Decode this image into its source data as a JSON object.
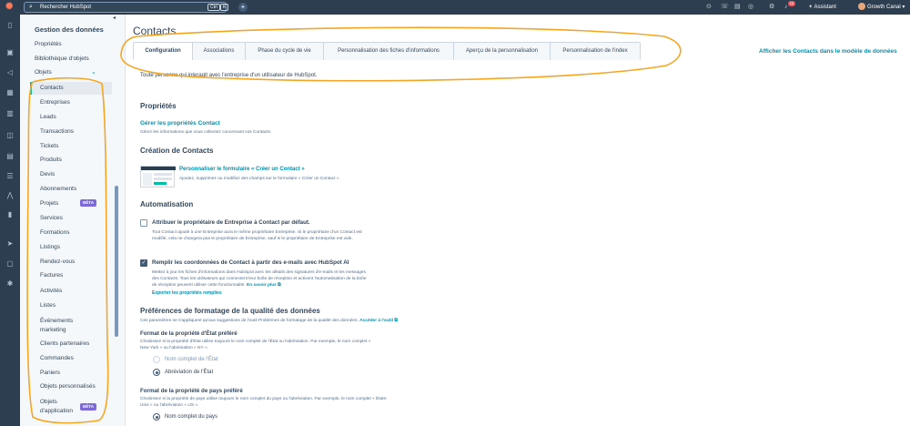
{
  "topbar": {
    "search_placeholder": "Rechercher HubSpot",
    "kbd_ctrl": "Ctrl",
    "kbd_k": "K",
    "notif_count": "18",
    "assistant": "Assistant",
    "account": "Growth Canal"
  },
  "sidebar": {
    "title": "Gestion des données",
    "links": [
      "Propriétés",
      "Bibliothèque d'objets"
    ],
    "objects_label": "Objets",
    "items": [
      "Contacts",
      "Entreprises",
      "Leads",
      "Transactions",
      "Tickets",
      "Produits",
      "Devis",
      "Abonnements",
      "Projets",
      "Services",
      "Formations",
      "Listings",
      "Rendez-vous",
      "Factures",
      "Activités",
      "Listes",
      "Événements marketing",
      "Clients partenaires",
      "Commandes",
      "Paniers",
      "Objets personnalisés",
      "Objets d'application"
    ],
    "beta": "BÊTA"
  },
  "main": {
    "title": "Contacts",
    "tabs": [
      "Configuration",
      "Associations",
      "Phase du cycle de vie",
      "Personnalisation des fiches d'informations",
      "Aperçu de la personnalisation",
      "Personnalisation de l'index"
    ],
    "model_link": "Afficher les Contacts dans le modèle de données",
    "description": "Toute personne qui interagit avec l'entreprise d'un utilisateur de HubSpot.",
    "props_heading": "Propriétés",
    "props_link": "Gérer les propriétés Contact",
    "props_desc": "Gérez les informations que vous collectez concernant vos Contacts.",
    "creation_heading": "Création de Contacts",
    "creation_link": "Personnaliser le formulaire « Créer un Contact »",
    "creation_desc": "Ajoutez, supprimez ou modifiez des champs sur le formulaire « Créer un Contact ».",
    "auto_heading": "Automatisation",
    "cb1_label": "Attribuer le propriétaire de Entreprise à Contact par défaut.",
    "cb1_desc": "Tout Contact ajouté à une Entreprise aura le même propriétaire Entreprise. Si le propriétaire d'un Contact est modifié, cela ne changera pas le propriétaire de Entreprise, sauf si le propriétaire de Entreprise est vide.",
    "cb2_label": "Remplir les coordonnées de Contact à partir des e-mails avec HubSpot AI",
    "cb2_desc": "Mettez à jour les fiches d'informations dans HubSpot avec les détails des signatures d'e-mails et les messages des Contacts. Tous les utilisateurs qui connectent leur boîte de réception et activent l'automatisation de la boîte de réception peuvent utiliser cette fonctionnalité.",
    "cb2_more": "En savoir plus",
    "cb2_export": "Exporter les propriétés remplies",
    "pref_heading": "Préférences de formatage de la qualité des données",
    "pref_desc": "Ces paramètres ne s'appliquent qu'aux suggestions de l'outil Problèmes de formatage de la qualité des données.",
    "pref_link": "Accéder à l'outil",
    "state_heading": "Format de la propriété d'État préféré",
    "state_desc": "Choisissez si la propriété d'État utilise toujours le nom complet de l'État ou l'abréviation. Par exemple, le nom complet « New York » ou l'abréviation « NY ».",
    "state_opt1": "Nom complet de l'État",
    "state_opt2": "Abréviation de l'État",
    "country_heading": "Format de la propriété de pays préféré",
    "country_desc": "Choisissez si la propriété de pays utilise toujours le nom complet du pays ou l'abréviation. Par exemple, le nom complet « États-Unis » ou l'abréviation « US ».",
    "country_opt1": "Nom complet du pays"
  },
  "colors": {
    "topbar": "#2d3e50",
    "accent_link": "#0091ae",
    "active_tab_marker": "#00bda5",
    "annotation": "#f5a623",
    "beta": "#7c6ad8"
  },
  "icons": [
    "hubspot-logo-icon",
    "search-icon",
    "plus-icon",
    "help-icon",
    "phone-icon",
    "marketplace-icon",
    "settings-icon",
    "bell-icon",
    "bookmark-icon",
    "send-icon",
    "contacts-icon",
    "reports-icon",
    "inbox-icon",
    "chevron-down-icon"
  ]
}
